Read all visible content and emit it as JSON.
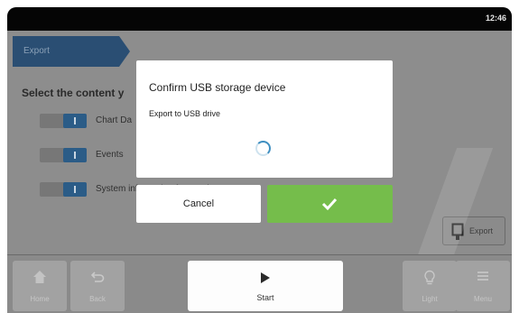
{
  "status": {
    "time": "12:46"
  },
  "screen": {
    "breadcrumb": "Export",
    "prompt": "Select the content y",
    "options": [
      {
        "label": "Chart Da"
      },
      {
        "label": "Events"
      },
      {
        "label": "System information for Service"
      }
    ],
    "export_button": "Export"
  },
  "nav": {
    "home": "Home",
    "back": "Back",
    "start": "Start",
    "light": "Light",
    "menu": "Menu"
  },
  "dialog": {
    "title": "Confirm USB storage device",
    "message": "Export to USB drive",
    "cancel": "Cancel"
  },
  "colors": {
    "accent_blue": "#2b5c87",
    "confirm_green": "#75bd4b",
    "spinner": "#3f8fc1"
  }
}
